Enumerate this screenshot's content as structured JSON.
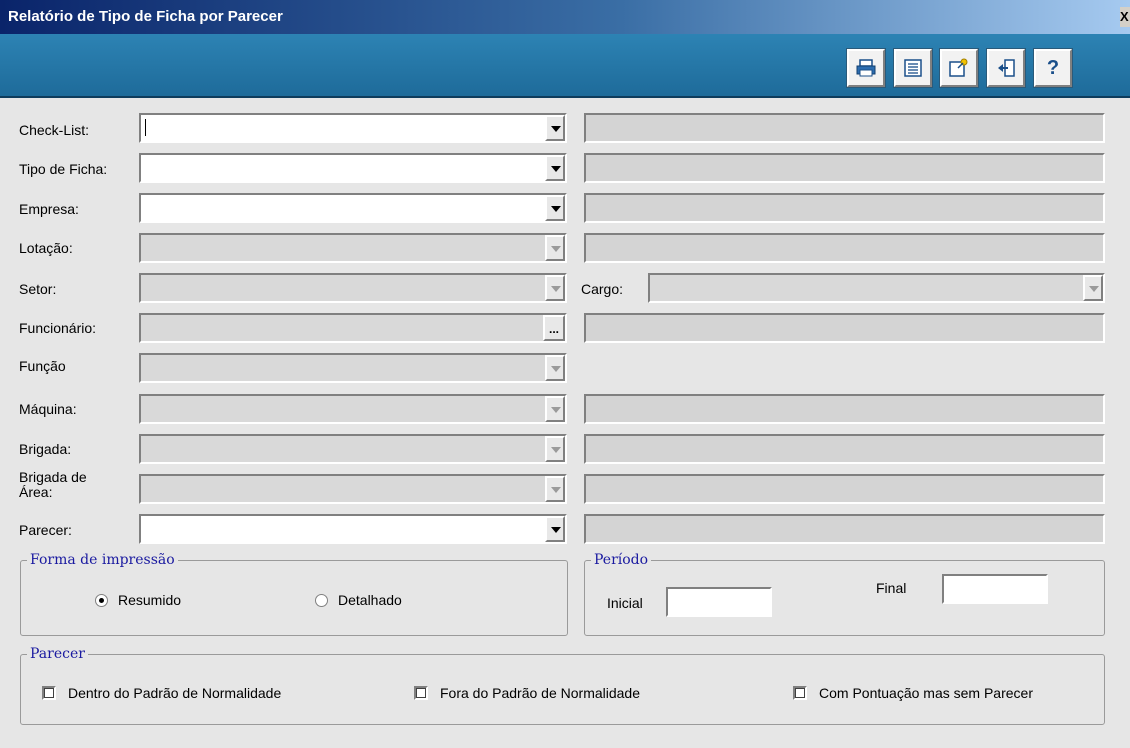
{
  "window": {
    "title": "Relatório de Tipo de Ficha por Parecer",
    "close_glyph": "X"
  },
  "toolbar": {
    "buttons": [
      {
        "icon": "printer-icon"
      },
      {
        "icon": "report-list-icon"
      },
      {
        "icon": "edit-note-icon"
      },
      {
        "icon": "exit-door-icon"
      },
      {
        "icon": "help-icon",
        "label": "?"
      }
    ]
  },
  "fields": {
    "checklist": {
      "label": "Check-List:",
      "value": ""
    },
    "tipo_ficha": {
      "label": "Tipo de Ficha:",
      "value": ""
    },
    "empresa": {
      "label": "Empresa:",
      "value": ""
    },
    "lotacao": {
      "label": "Lotação:",
      "value": ""
    },
    "setor": {
      "label": "Setor:",
      "value": ""
    },
    "cargo": {
      "label": "Cargo:",
      "value": ""
    },
    "funcionario": {
      "label": "Funcionário:",
      "value": "",
      "button": "..."
    },
    "funcao": {
      "label": "Função",
      "value": ""
    },
    "maquina": {
      "label": "Máquina:",
      "value": ""
    },
    "brigada": {
      "label": "Brigada:",
      "value": ""
    },
    "brigada_area": {
      "label_line1": "Brigada de",
      "label_line2": "Área:",
      "value": ""
    },
    "parecer": {
      "label": "Parecer:",
      "value": ""
    }
  },
  "forma_impressao": {
    "legend": "Forma de impressão",
    "options": [
      {
        "label": "Resumido",
        "selected": true
      },
      {
        "label": "Detalhado",
        "selected": false
      }
    ]
  },
  "periodo": {
    "legend": "Período",
    "inicial_label": "Inicial",
    "inicial_value": "",
    "final_label": "Final",
    "final_value": ""
  },
  "parecer_group": {
    "legend": "Parecer",
    "options": [
      {
        "label": "Dentro do Padrão de Normalidade",
        "checked": false
      },
      {
        "label": "Fora do Padrão de Normalidade",
        "checked": false
      },
      {
        "label": "Com Pontuação mas sem Parecer",
        "checked": false
      }
    ]
  }
}
